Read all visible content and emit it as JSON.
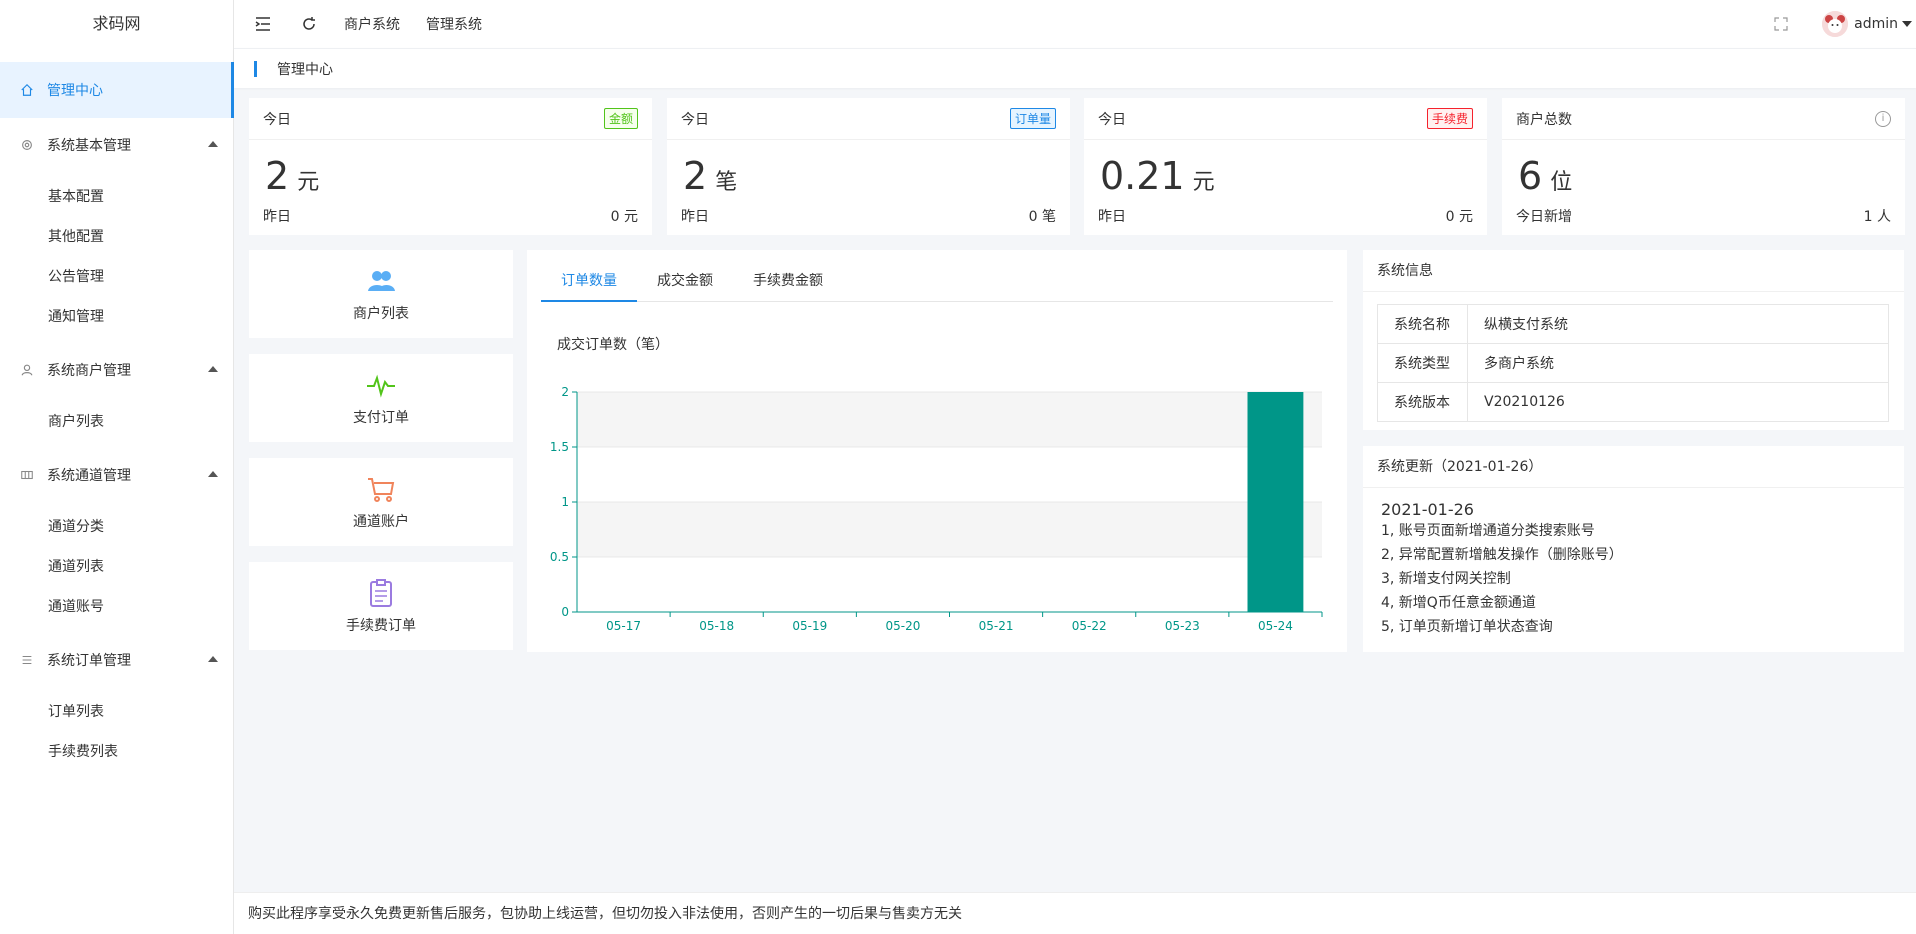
{
  "sidebar": {
    "logo": "求码网",
    "active_item": "管理中心",
    "groups": [
      {
        "label": "系统基本管理",
        "items": [
          "基本配置",
          "其他配置",
          "公告管理",
          "通知管理"
        ]
      },
      {
        "label": "系统商户管理",
        "items": [
          "商户列表"
        ]
      },
      {
        "label": "系统通道管理",
        "items": [
          "通道分类",
          "通道列表",
          "通道账号"
        ]
      },
      {
        "label": "系统订单管理",
        "items": [
          "订单列表",
          "手续费列表"
        ]
      }
    ]
  },
  "header": {
    "links": [
      "商户系统",
      "管理系统"
    ],
    "user": "admin"
  },
  "breadcrumb": "管理中心",
  "stats": [
    {
      "label": "今日",
      "badge": "金额",
      "value": "2",
      "unit": "元",
      "foot_label": "昨日",
      "foot_value": "0 元",
      "badge_color": "#52c41a"
    },
    {
      "label": "今日",
      "badge": "订单量",
      "value": "2",
      "unit": "笔",
      "foot_label": "昨日",
      "foot_value": "0 笔",
      "badge_color": "#1e88e5"
    },
    {
      "label": "今日",
      "badge": "手续费",
      "value": "0.21",
      "unit": "元",
      "foot_label": "昨日",
      "foot_value": "0 元",
      "badge_color": "#f5222d"
    },
    {
      "label": "商户总数",
      "badge": "",
      "value": "6",
      "unit": "位",
      "foot_label": "今日新增",
      "foot_value": "1 人",
      "badge_color": ""
    }
  ],
  "tiles": [
    {
      "label": "商户列表",
      "icon": "users-icon",
      "color": "#5aaef5"
    },
    {
      "label": "支付订单",
      "icon": "pulse-icon",
      "color": "#52c41a"
    },
    {
      "label": "通道账户",
      "icon": "cart-icon",
      "color": "#f0845b"
    },
    {
      "label": "手续费订单",
      "icon": "clipboard-icon",
      "color": "#9b7be0"
    }
  ],
  "chart_tabs": [
    "订单数量",
    "成交金额",
    "手续费金额"
  ],
  "chart_data": {
    "type": "bar",
    "title": "成交订单数（笔）",
    "categories": [
      "05-17",
      "05-18",
      "05-19",
      "05-20",
      "05-21",
      "05-22",
      "05-23",
      "05-24"
    ],
    "values": [
      0,
      0,
      0,
      0,
      0,
      0,
      0,
      2
    ],
    "ylim": [
      0,
      2
    ],
    "yticks": [
      "0",
      "0.5",
      "1",
      "1.5",
      "2"
    ],
    "bar_color": "#009688",
    "axis_color": "#009688"
  },
  "sys_info": {
    "title": "系统信息",
    "rows": [
      {
        "k": "系统名称",
        "v": "纵横支付系统"
      },
      {
        "k": "系统类型",
        "v": "多商户系统"
      },
      {
        "k": "系统版本",
        "v": "V20210126"
      }
    ]
  },
  "sys_update": {
    "title": "系统更新（2021-01-26）",
    "date": "2021-01-26",
    "lines": [
      "1, 账号页面新增通道分类搜索账号",
      "2, 异常配置新增触发操作（删除账号）",
      "3, 新增支付网关控制",
      "4, 新增Q币任意金额通道",
      "5, 订单页新增订单状态查询"
    ]
  },
  "footer": "购买此程序享受永久免费更新售后服务，包协助上线运营，但切勿投入非法使用，否则产生的一切后果与售卖方无关"
}
